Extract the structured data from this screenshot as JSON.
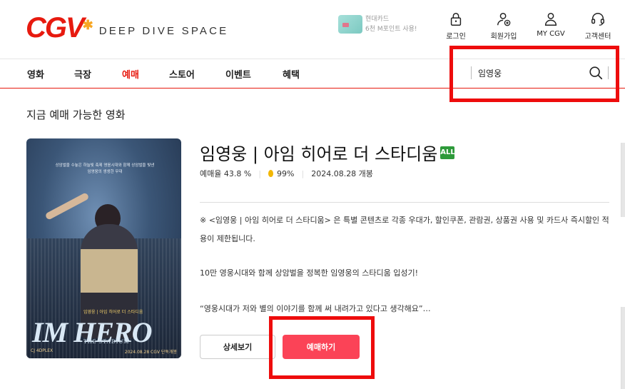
{
  "header": {
    "logo_text": "CGV",
    "tagline": "DEEP DIVE SPACE",
    "card_ad": {
      "line1": "현대카드",
      "line2": "6천 M포인트 사용!"
    },
    "utility": [
      {
        "label": "로그인",
        "icon": "lock-icon"
      },
      {
        "label": "회원가입",
        "icon": "user-plus-icon"
      },
      {
        "label": "MY CGV",
        "icon": "user-icon"
      },
      {
        "label": "고객센터",
        "icon": "headset-icon"
      }
    ]
  },
  "nav": {
    "items": [
      {
        "label": "영화"
      },
      {
        "label": "극장"
      },
      {
        "label": "예매",
        "active": true
      },
      {
        "label": "스토어"
      },
      {
        "label": "이벤트"
      },
      {
        "label": "혜택"
      }
    ],
    "search": {
      "value": "임영웅",
      "icon": "search-icon"
    }
  },
  "section_title": "지금 예매 가능한 영화",
  "movie": {
    "title": "임영웅 | 아임 히어로 더 스타디움",
    "age_rating": "ALL",
    "booking_rate": "예매율 43.8 %",
    "egg_score": "99%",
    "release": "2024.08.28 개봉",
    "description": [
      "※ <임영웅 | 아임 히어로 더 스타디움> 은 특별 콘텐츠로 각종 우대가, 할인쿠폰, 관람권, 상품권 사용 및 카드사 즉시할인 적용이 제한됩니다.",
      "10만 영웅시대와 함께 상암벌을 정복한 임영웅의 스타디움 입성기!",
      "“영웅시대가 저와 별의 이야기를 함께 써 내려가고 있다고 생각해요”…"
    ],
    "poster": {
      "logo": "IM HERO",
      "sub": "THE STADIUM",
      "badge": "임영웅 | 아임 히어로 더 스타디움",
      "copy": "상암벌을 수놓은 하늘빛 축제 영웅시대와 함께 상암벌을 빛낸 임영웅의 생생한 무대",
      "bottom_left": "CJ 4DPLEX",
      "bottom_right": "2024.08.28 CGV 단독개봉"
    },
    "detail_button": "상세보기",
    "book_button": "예매하기"
  },
  "colors": {
    "brand_red": "#e71a0f",
    "book_button": "#fb4357",
    "highlight": "#ee0c0c",
    "age_all": "#2e9a3a"
  }
}
